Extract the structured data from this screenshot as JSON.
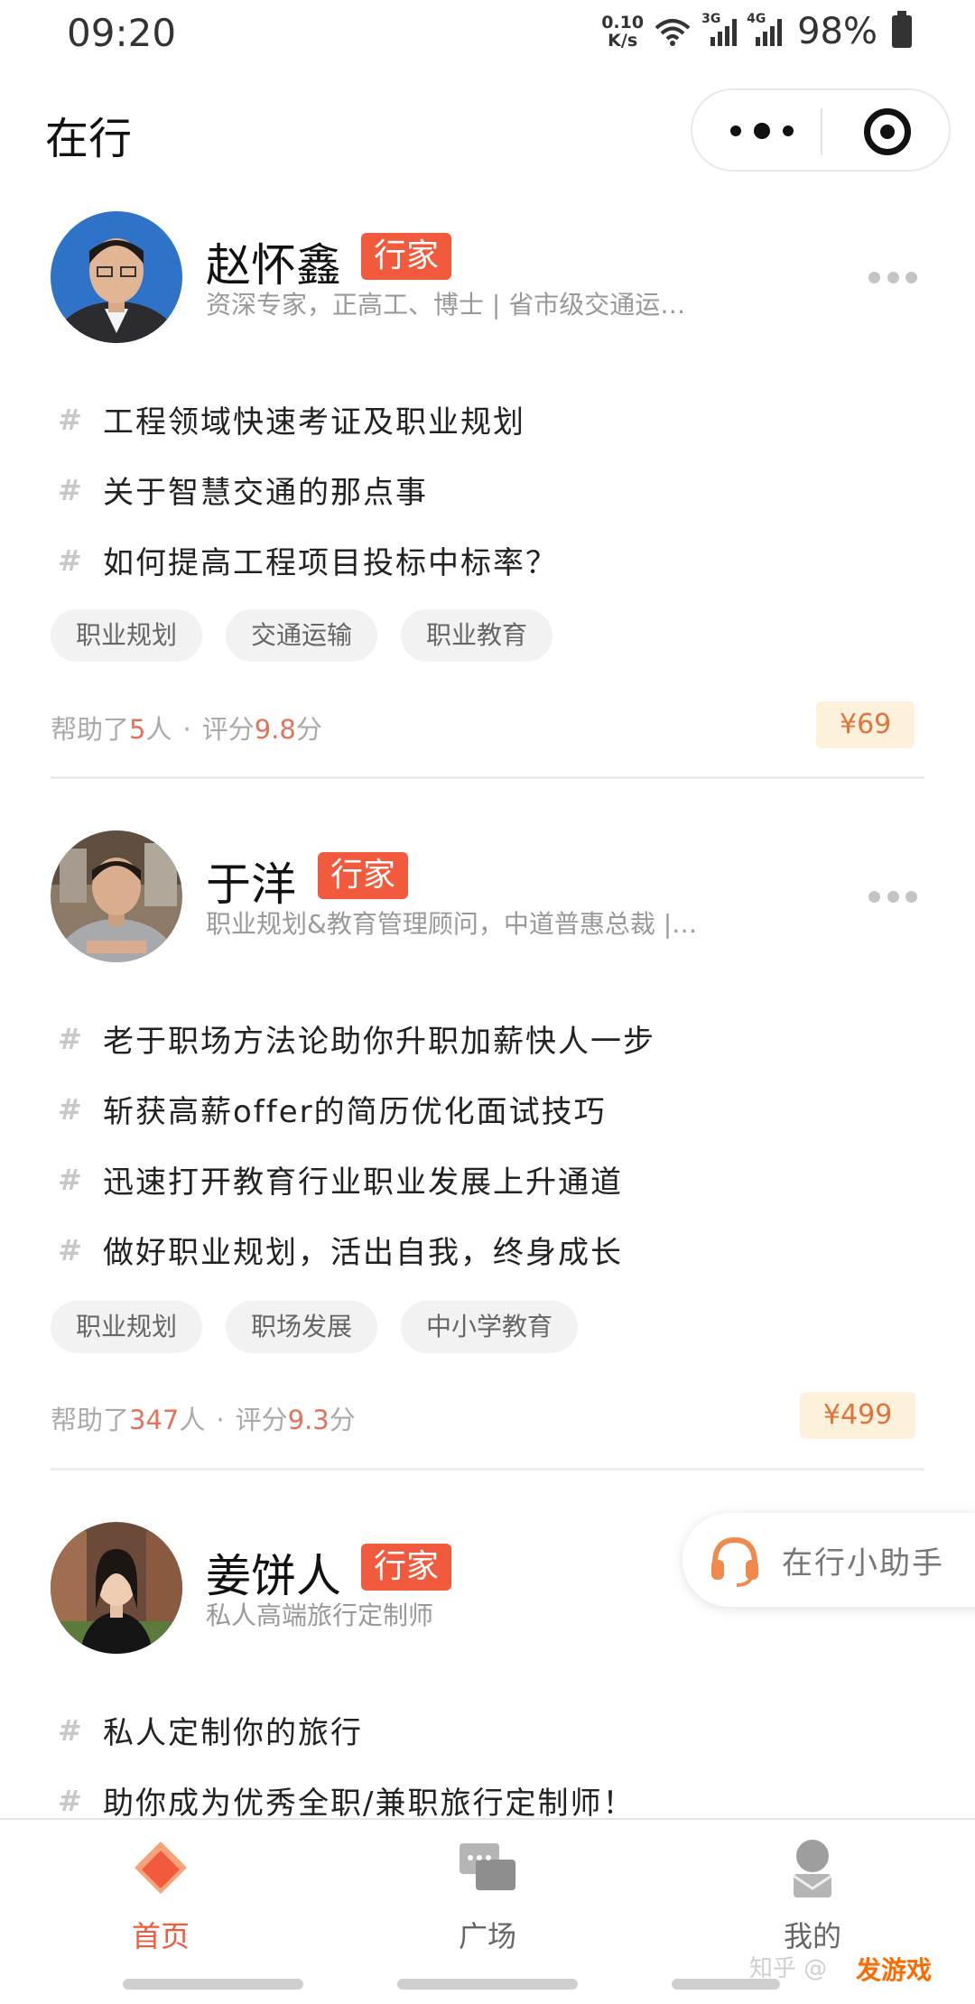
{
  "status_bar": {
    "time": "09:20",
    "speed_value": "0.10",
    "speed_unit": "K/s",
    "network_1": "3G",
    "network_2": "4G",
    "battery": "98%"
  },
  "app": {
    "title": "在行"
  },
  "experts": [
    {
      "name": "赵怀鑫",
      "badge": "行家",
      "subtitle": "资深专家，正高工、博士 | 省市级交通运…",
      "topics": [
        "工程领域快速考证及职业规划",
        "关于智慧交通的那点事",
        "如何提高工程项目投标中标率？"
      ],
      "tags": [
        "职业规划",
        "交通运输",
        "职业教育"
      ],
      "helped_prefix": "帮助了",
      "helped_count": "5",
      "helped_suffix": "人",
      "rating_prefix": "评分",
      "rating": "9.8",
      "rating_suffix": "分",
      "price": "¥69"
    },
    {
      "name": "于洋",
      "badge": "行家",
      "subtitle": "职业规划&教育管理顾问，中道普惠总裁 |…",
      "topics": [
        "老于职场方法论助你升职加薪快人一步",
        "斩获高薪offer的简历优化面试技巧",
        "迅速打开教育行业职业发展上升通道",
        "做好职业规划，活出自我，终身成长"
      ],
      "tags": [
        "职业规划",
        "职场发展",
        "中小学教育"
      ],
      "helped_prefix": "帮助了",
      "helped_count": "347",
      "helped_suffix": "人",
      "rating_prefix": "评分",
      "rating": "9.3",
      "rating_suffix": "分",
      "price": "¥499"
    },
    {
      "name": "姜饼人",
      "badge": "行家",
      "subtitle": "私人高端旅行定制师",
      "topics": [
        "私人定制你的旅行",
        "助你成为优秀全职/兼职旅行定制师！"
      ]
    }
  ],
  "helper": {
    "label": "在行小助手",
    "icon": "headset-icon"
  },
  "nav": [
    {
      "label": "首页",
      "icon": "home-diamond-icon",
      "active": true
    },
    {
      "label": "广场",
      "icon": "chat-bubbles-icon",
      "active": false
    },
    {
      "label": "我的",
      "icon": "person-icon",
      "active": false
    }
  ],
  "watermark": {
    "text_1": "知乎 @",
    "logo": "发游戏"
  },
  "colors": {
    "accent": "#f25a3d",
    "price_bg": "#fdf1db",
    "price_text": "#e0743d",
    "stat_highlight": "#e2725a"
  }
}
